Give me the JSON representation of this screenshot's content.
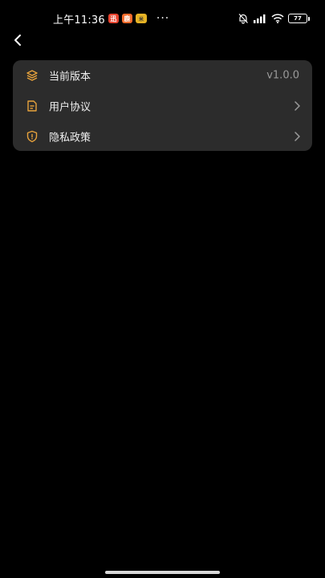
{
  "status_bar": {
    "time": "上午11:36",
    "app_badges": [
      "迅",
      "鹿",
      "米"
    ],
    "more": "···",
    "battery": "77"
  },
  "settings": {
    "version": {
      "label": "当前版本",
      "value": "v1.0.0",
      "icon": "layers-icon"
    },
    "user_agreement": {
      "label": "用户协议",
      "icon": "document-icon"
    },
    "privacy_policy": {
      "label": "隐私政策",
      "icon": "shield-icon"
    }
  },
  "colors": {
    "background": "#000000",
    "card": "#2c2c2c",
    "accent": "#e8a33c",
    "text": "#f0f0f0",
    "muted": "#9a9a9a"
  }
}
